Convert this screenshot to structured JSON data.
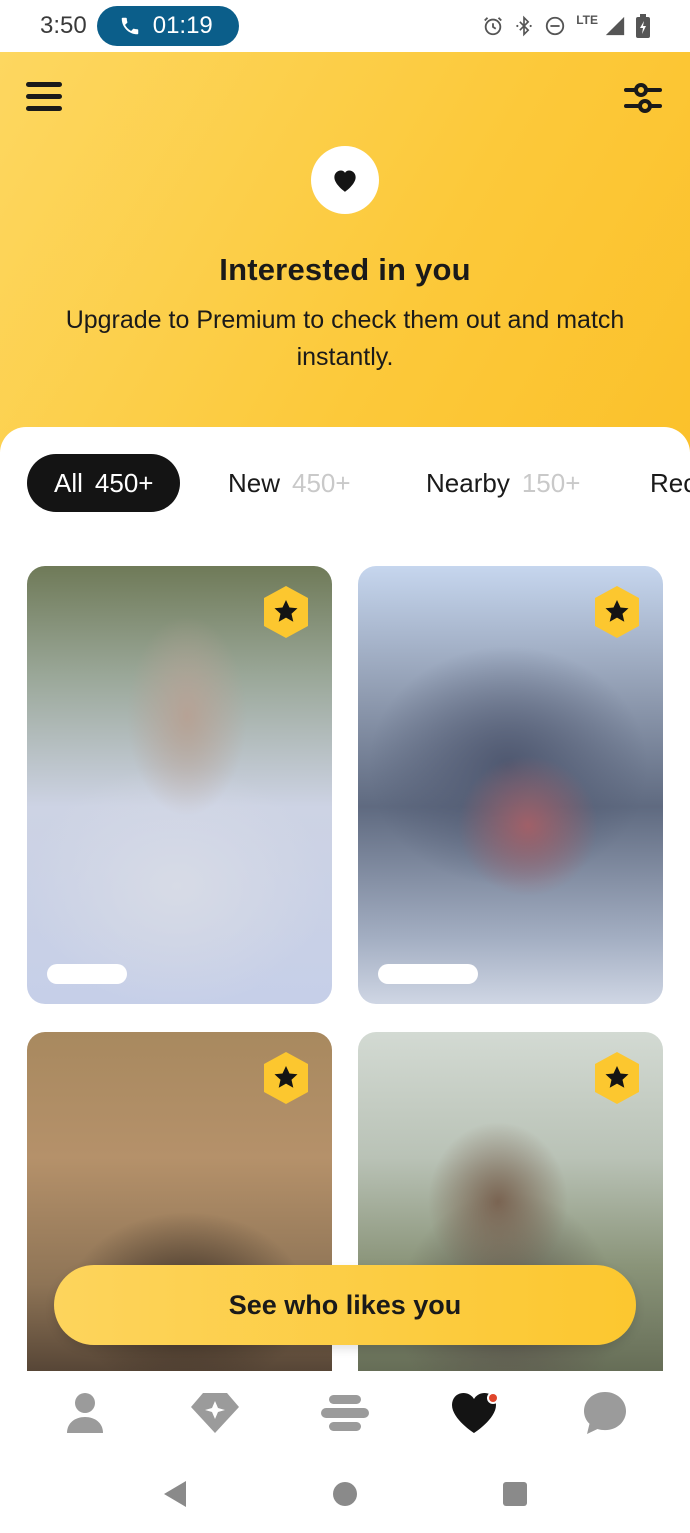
{
  "status_bar": {
    "time": "3:50",
    "call_timer": "01:19",
    "network_label": "LTE",
    "icons": [
      "alarm-icon",
      "bluetooth-icon",
      "do-not-disturb-icon",
      "signal-icon",
      "battery-icon"
    ]
  },
  "header": {
    "title": "Interested in you",
    "subtitle": "Upgrade to Premium to check them out and match instantly.",
    "background_color": "#fcc93a"
  },
  "tabs": [
    {
      "label": "All",
      "count": "450+",
      "active": true
    },
    {
      "label": "New",
      "count": "450+",
      "active": false
    },
    {
      "label": "Nearby",
      "count": "150+",
      "active": false
    },
    {
      "label": "Rec",
      "count": "",
      "active": false
    }
  ],
  "cards": [
    {
      "badge": "star-badge-icon",
      "blurred": true
    },
    {
      "badge": "star-badge-icon",
      "blurred": true
    },
    {
      "badge": "star-badge-icon",
      "blurred": true
    },
    {
      "badge": "star-badge-icon",
      "blurred": true
    }
  ],
  "cta": {
    "label": "See who likes you",
    "color": "#fcc72f"
  },
  "bottom_nav": [
    {
      "icon": "profile-icon"
    },
    {
      "icon": "discover-icon"
    },
    {
      "icon": "people-icon"
    },
    {
      "icon": "liked-you-icon",
      "active": true,
      "notification": true
    },
    {
      "icon": "chat-icon"
    }
  ],
  "system_nav": [
    "back-icon",
    "home-icon",
    "recents-icon"
  ]
}
